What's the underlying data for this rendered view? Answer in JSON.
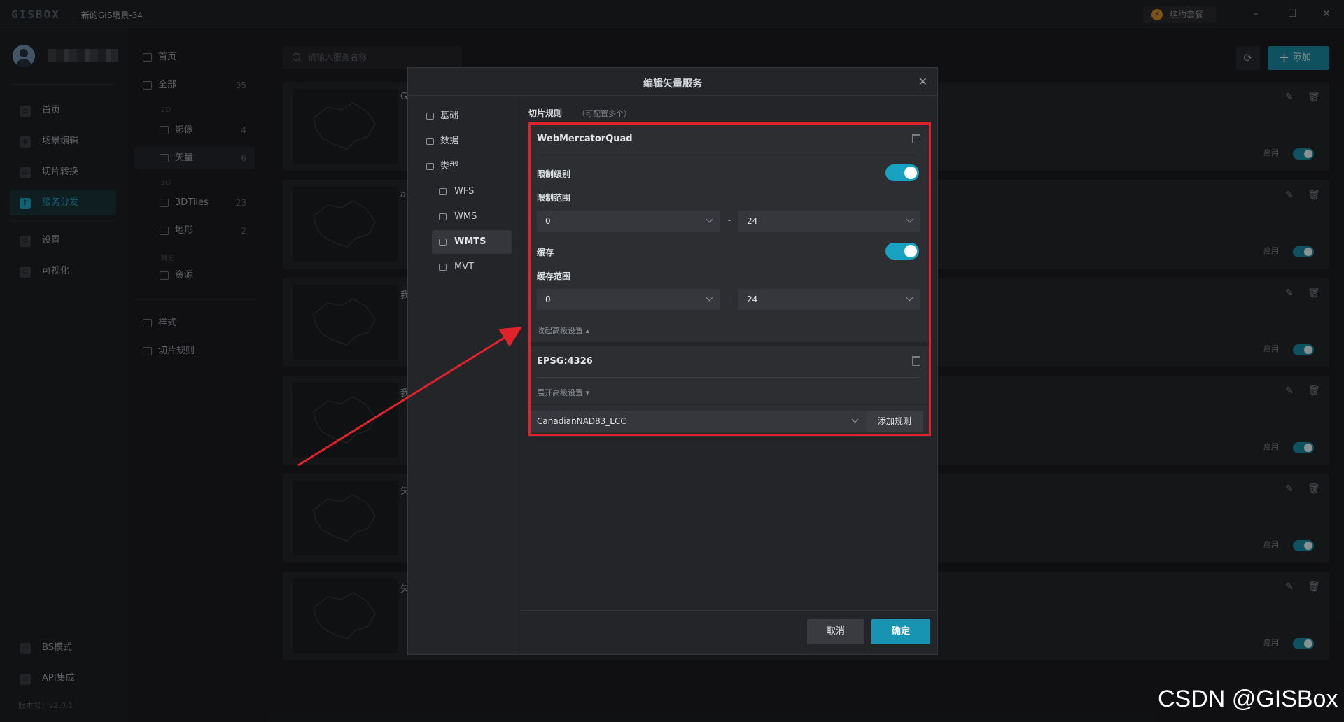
{
  "app": {
    "logo": "GISBOX",
    "scene_title": "新的GIS场景-34",
    "renew_label": "续约套餐",
    "window_controls": [
      "minimize-icon",
      "maximize-icon",
      "close-icon"
    ]
  },
  "sidebar": {
    "items": [
      {
        "label": "首页",
        "icon": "home-icon"
      },
      {
        "label": "场景编辑",
        "icon": "cube-icon"
      },
      {
        "label": "切片转换",
        "icon": "swap-icon"
      },
      {
        "label": "服务分发",
        "icon": "upload-icon",
        "active": true
      },
      {
        "label": "设置",
        "icon": "gear-icon"
      },
      {
        "label": "可视化",
        "icon": "chart-icon"
      }
    ],
    "bottom_items": [
      {
        "label": "BS模式",
        "icon": "code-icon"
      },
      {
        "label": "API集成",
        "icon": "link-icon"
      }
    ],
    "version": "版本号：v2.0.1"
  },
  "categories": {
    "home": "首页",
    "all": {
      "label": "全部",
      "count": "35"
    },
    "group_2d": "2D",
    "imagery": {
      "label": "影像",
      "count": "4"
    },
    "vector": {
      "label": "矢量",
      "count": "6"
    },
    "group_3d": "3D",
    "tiles3d": {
      "label": "3DTiles",
      "count": "23"
    },
    "terrain": {
      "label": "地形",
      "count": "2"
    },
    "group_other": "其它",
    "resource": {
      "label": "资源"
    },
    "style": "样式",
    "tile_rules": "切片规则"
  },
  "toolbar": {
    "search_placeholder": "请输入服务名称",
    "add_label": "添加"
  },
  "cards": [
    {
      "initial": "G",
      "enable_label": "启用"
    },
    {
      "initial": "a",
      "enable_label": "启用"
    },
    {
      "initial": "我",
      "enable_label": "启用"
    },
    {
      "initial": "我",
      "enable_label": "启用"
    },
    {
      "initial": "矢",
      "enable_label": "启用"
    },
    {
      "initial": "矢",
      "enable_label": "启用"
    }
  ],
  "dialog": {
    "title": "编辑矢量服务",
    "nav": {
      "basic": "基础",
      "data": "数据",
      "type": "类型",
      "wfs": "WFS",
      "wms": "WMS",
      "wmts": "WMTS",
      "mvt": "MVT"
    },
    "section_label": "切片规则",
    "section_hint": "（可配置多个）",
    "rule1": {
      "name": "WebMercatorQuad",
      "limit_level_label": "限制级别",
      "limit_range_label": "限制范围",
      "limit_min": "0",
      "limit_max": "24",
      "cache_label": "缓存",
      "cache_range_label": "缓存范围",
      "cache_min": "0",
      "cache_max": "24",
      "collapse_label": "收起高级设置"
    },
    "rule2": {
      "name": "EPSG:4326",
      "expand_label": "展开高级设置"
    },
    "add_rule": {
      "select_value": "CanadianNAD83_LCC",
      "button_label": "添加规则"
    },
    "range_separator": "-",
    "cancel_label": "取消",
    "ok_label": "确定"
  },
  "annotation": {
    "highlight_color": "#e0232b",
    "watermark": "CSDN @GISBox"
  },
  "colors": {
    "accent": "#1794b1",
    "toggle_on": "#17a2c2",
    "background": "#1b1c1f"
  }
}
